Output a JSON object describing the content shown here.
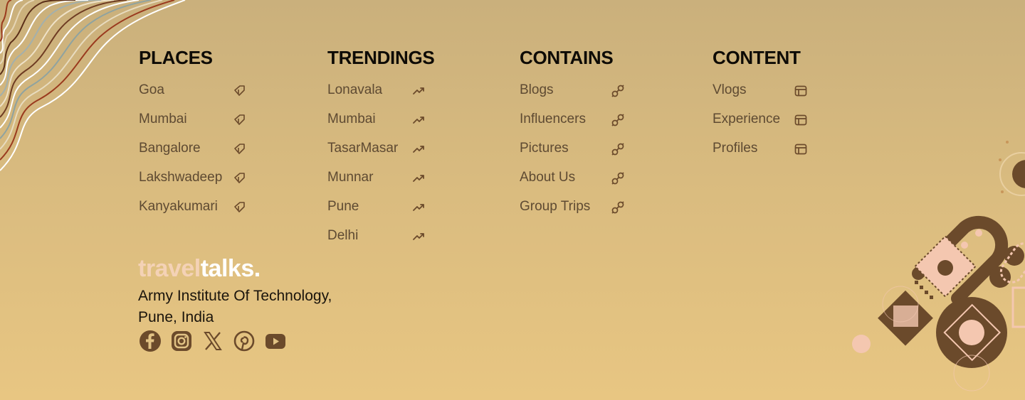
{
  "colors": {
    "heading": "#0e0b06",
    "link": "#5e4a32",
    "brand_light": "#f4d2b6",
    "brand_white": "#ffffff",
    "icon_brown": "#6b4a2b"
  },
  "columns": {
    "places": {
      "title": "PLACES",
      "icon": "tag-icon",
      "items": [
        "Goa",
        "Mumbai",
        "Bangalore",
        "Lakshwadeep",
        "Kanyakumari"
      ]
    },
    "trendings": {
      "title": "TRENDINGS",
      "icon": "trending-up-icon",
      "items": [
        "Lonavala",
        "Mumbai",
        "TasarMasar",
        "Munnar",
        "Pune",
        "Delhi"
      ]
    },
    "contains": {
      "title": "CONTAINS",
      "icon": "link-icon",
      "items": [
        "Blogs",
        "Influencers",
        "Pictures",
        "About Us",
        "Group Trips"
      ]
    },
    "content": {
      "title": "CONTENT",
      "icon": "layout-icon",
      "items": [
        "Vlogs",
        "Experience",
        "Profiles"
      ]
    }
  },
  "brand": {
    "part1": "travel",
    "part2": "talks."
  },
  "address": {
    "line1": "Army Institute Of Technology,",
    "line2": "Pune, India"
  },
  "social": [
    "facebook-icon",
    "instagram-icon",
    "x-icon",
    "pinterest-icon",
    "youtube-icon"
  ]
}
